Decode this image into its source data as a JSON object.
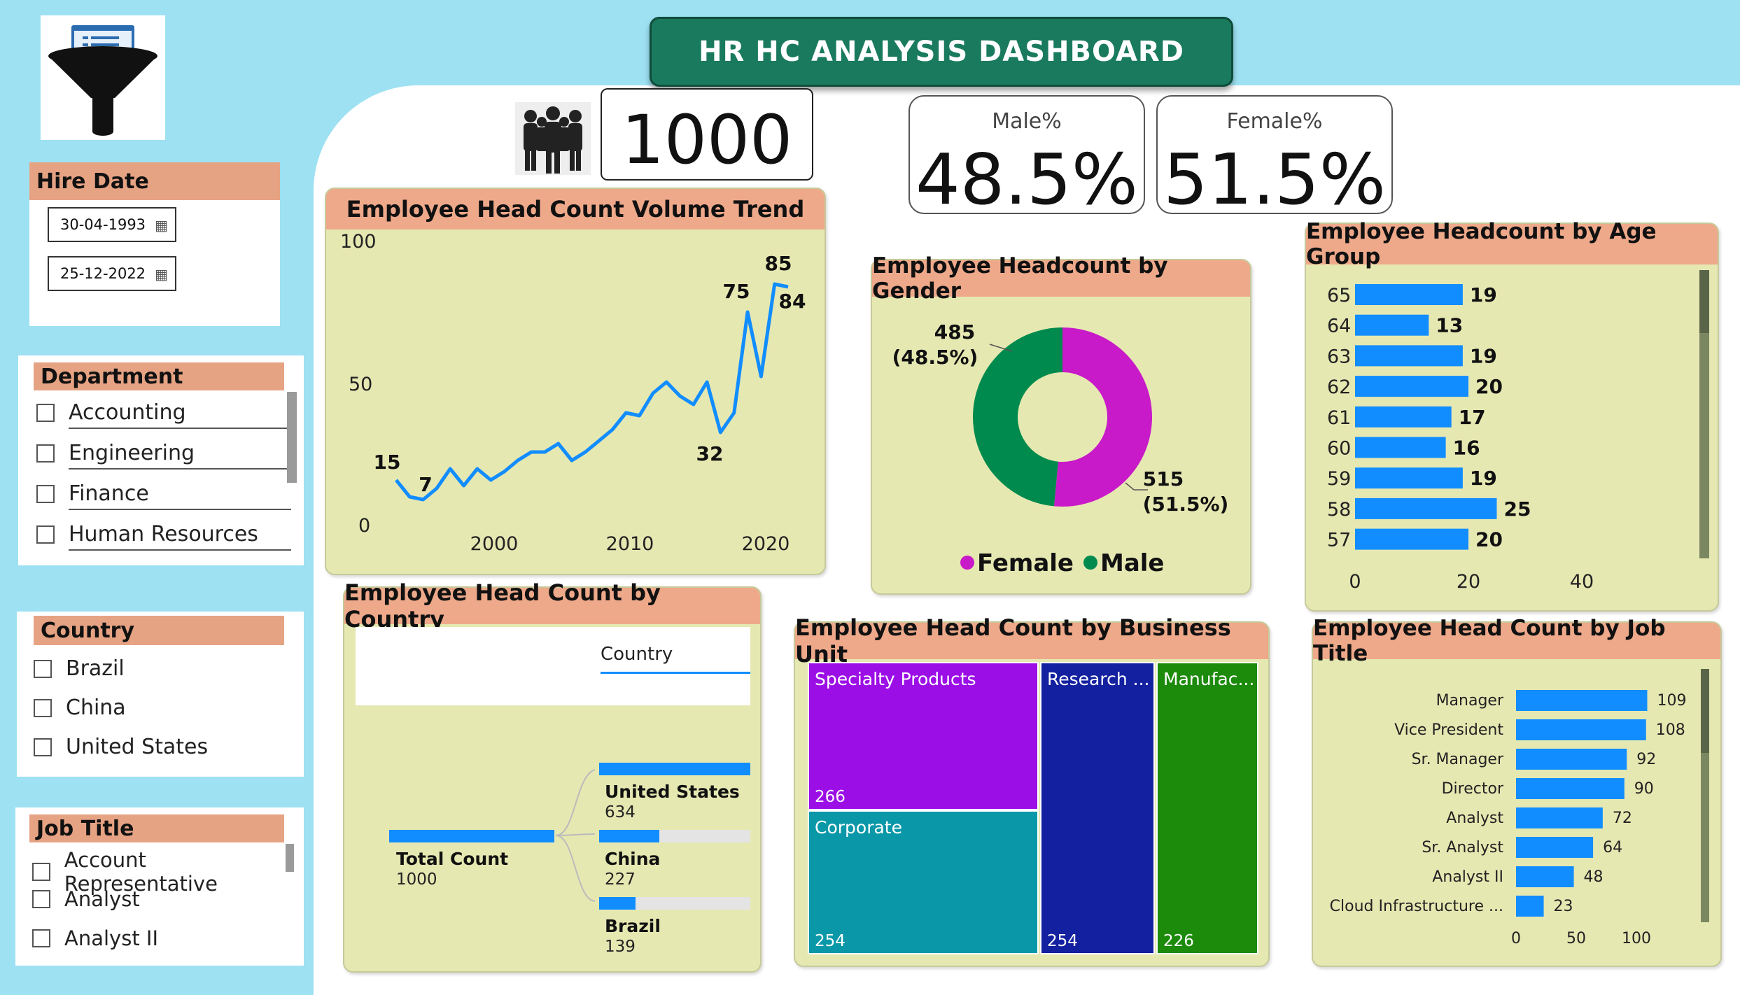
{
  "title": "HR HC ANALYSIS DASHBOARD",
  "icons": {
    "logo": "funnel-filter-icon",
    "people": "people-group-icon",
    "calendar": "calendar-icon"
  },
  "colors": {
    "accent": "#1a7a5e",
    "slicer_head": "#e6a383",
    "card_bg": "#e6e8b2",
    "bar": "#118dff",
    "female": "#c81ac8",
    "male": "#008a4d"
  },
  "kpis": {
    "total_employees": "1000",
    "male_label": "Male%",
    "male_value": "48.5%",
    "female_label": "Female%",
    "female_value": "51.5%"
  },
  "hire_date": {
    "title": "Hire Date",
    "start": "30-04-1993",
    "end": "25-12-2022"
  },
  "department": {
    "title": "Department",
    "items": [
      "Accounting",
      "Engineering",
      "Finance",
      "Human Resources"
    ]
  },
  "country_slicer": {
    "title": "Country",
    "items": [
      "Brazil",
      "China",
      "United States"
    ]
  },
  "job_title_slicer": {
    "title": "Job Title",
    "items": [
      "Account Representative",
      "Analyst",
      "Analyst II"
    ]
  },
  "trend": {
    "title": "Employee Head Count Volume Trend",
    "y_ticks": [
      "100",
      "50",
      "0"
    ],
    "x_ticks": [
      "2000",
      "2010",
      "2020"
    ],
    "labels": {
      "first": "15",
      "low": "7",
      "dip": "32",
      "peak1": "75",
      "peak2": "85",
      "last": "84"
    }
  },
  "gender": {
    "title": "Employee Headcount by Gender",
    "male_label": "485",
    "male_pct": "(48.5%)",
    "female_label": "515",
    "female_pct": "(51.5%)",
    "legend_female": "Female",
    "legend_male": "Male"
  },
  "age": {
    "title": "Employee Headcount by Age Group",
    "x_ticks": [
      "0",
      "20",
      "40"
    ]
  },
  "country_tree": {
    "title": "Employee Head Count by Country",
    "field_label": "Country",
    "root_label": "Total Count",
    "root_value": "1000",
    "nodes": [
      {
        "name": "United States",
        "value": "634"
      },
      {
        "name": "China",
        "value": "227"
      },
      {
        "name": "Brazil",
        "value": "139"
      }
    ]
  },
  "business_unit": {
    "title": "Employee Head Count by Business Unit",
    "cells": [
      {
        "name": "Specialty Products",
        "value": "266"
      },
      {
        "name": "Corporate",
        "value": "254"
      },
      {
        "name": "Research ...",
        "value": "254"
      },
      {
        "name": "Manufac...",
        "value": "226"
      }
    ]
  },
  "job_title_chart": {
    "title": "Employee Head Count by Job Title",
    "x_ticks": [
      "0",
      "50",
      "100"
    ]
  },
  "chart_data": [
    {
      "type": "line",
      "title": "Employee Head Count Volume Trend",
      "x": [
        1993,
        1994,
        1995,
        1996,
        1997,
        1998,
        1999,
        2000,
        2001,
        2002,
        2003,
        2004,
        2005,
        2006,
        2007,
        2008,
        2009,
        2010,
        2011,
        2012,
        2013,
        2014,
        2015,
        2016,
        2017,
        2018,
        2019,
        2020,
        2021,
        2022
      ],
      "values": [
        15,
        9,
        8,
        12,
        19,
        13,
        19,
        15,
        18,
        22,
        25,
        25,
        28,
        22,
        25,
        29,
        33,
        39,
        38,
        46,
        50,
        45,
        42,
        50,
        32,
        39,
        75,
        52,
        85,
        84
      ],
      "ylim": [
        0,
        100
      ]
    },
    {
      "type": "pie",
      "title": "Employee Headcount by Gender",
      "categories": [
        "Female",
        "Male"
      ],
      "values": [
        515,
        485
      ]
    },
    {
      "type": "bar",
      "title": "Employee Headcount by Age Group",
      "categories": [
        "65",
        "64",
        "63",
        "62",
        "61",
        "60",
        "59",
        "58",
        "57"
      ],
      "values": [
        19,
        13,
        19,
        20,
        17,
        16,
        19,
        25,
        20
      ],
      "xlim": [
        0,
        50
      ]
    },
    {
      "type": "bar",
      "title": "Employee Head Count by Job Title",
      "categories": [
        "Manager",
        "Vice President",
        "Sr. Manager",
        "Director",
        "Analyst",
        "Sr. Analyst",
        "Analyst II",
        "Cloud Infrastructure ..."
      ],
      "values": [
        109,
        108,
        92,
        90,
        72,
        64,
        48,
        23
      ],
      "xlim": [
        0,
        120
      ]
    }
  ]
}
